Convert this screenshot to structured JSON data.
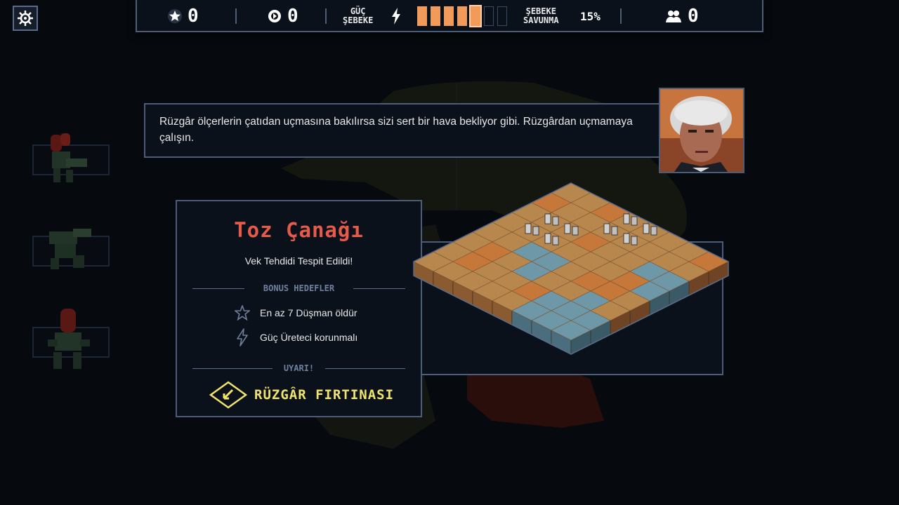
{
  "topbar": {
    "stars": "0",
    "reputation": "0",
    "power_label": "GÜÇ\nŞEBEKE",
    "power_level": 5,
    "power_max": 7,
    "defense_label": "ŞEBEKE\nSAVUNMA",
    "defense_pct": "15%",
    "civilians": "0"
  },
  "dialog": {
    "text": "Rüzgâr ölçerlerin çatıdan uçmasına bakılırsa sizi sert bir hava bekliyor gibi. Rüzgârdan uçmamaya çalışın."
  },
  "mission": {
    "title": "Toz Çanağı",
    "subtitle": "Vek Tehdidi Tespit Edildi!",
    "bonus_header": "BONUS HEDEFLER",
    "objectives": [
      {
        "icon": "star-icon",
        "text": "En az 7 Düşman öldür"
      },
      {
        "icon": "lightning-icon",
        "text": "Güç Üreteci korunmalı"
      }
    ],
    "warning_header": "UYARI!",
    "warning_text": "RÜZGÂR FIRTINASI"
  },
  "colors": {
    "accent_red": "#e65a4a",
    "power_orange": "#f19a5a",
    "warning_yellow": "#f0e46a",
    "border": "#4d5c78"
  }
}
